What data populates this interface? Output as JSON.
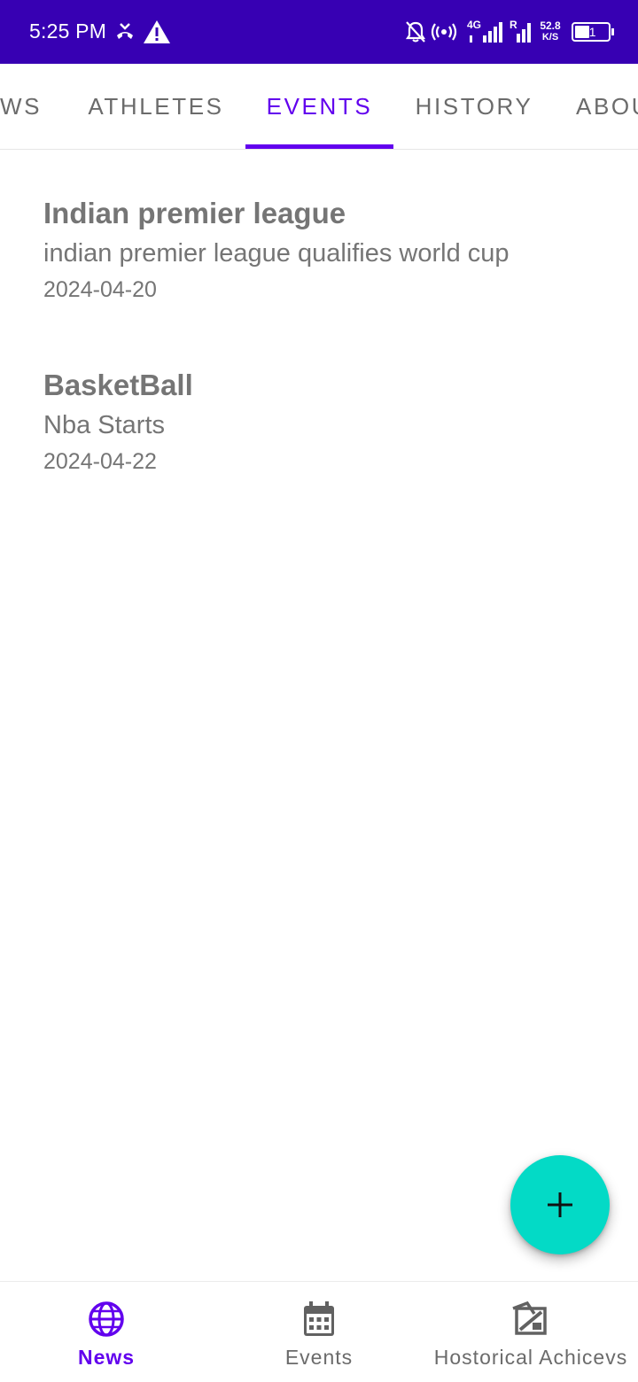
{
  "status_bar": {
    "time": "5:25 PM",
    "network_type": "4G",
    "roaming": "R",
    "speed_value": "52.8",
    "speed_unit": "K/S",
    "battery": "41",
    "icons": [
      "missed-call-icon",
      "warning-icon",
      "bell-off-icon",
      "hotspot-icon",
      "signal-icon",
      "signal-icon",
      "battery-icon"
    ]
  },
  "tabs": [
    {
      "label": "NEWS",
      "visible_text": "WS"
    },
    {
      "label": "ATHLETES"
    },
    {
      "label": "EVENTS",
      "active": true
    },
    {
      "label": "HISTORY"
    },
    {
      "label": "ABOUT",
      "visible_text": "ABOU"
    }
  ],
  "events": [
    {
      "title": "Indian premier league",
      "description": "indian premier league qualifies world cup",
      "date": "2024-04-20"
    },
    {
      "title": "BasketBall",
      "description": "Nba Starts",
      "date": "2024-04-22"
    }
  ],
  "fab": {
    "icon": "plus-icon",
    "color": "#03dac6"
  },
  "bottom_nav": [
    {
      "label": "News",
      "icon": "globe-icon",
      "active": true
    },
    {
      "label": "Events",
      "icon": "calendar-icon"
    },
    {
      "label": "Hostorical Achicevs",
      "icon": "history-icon"
    }
  ],
  "colors": {
    "status_bar": "#3700b3",
    "primary": "#6200ee",
    "accent": "#03dac6",
    "text_secondary": "#757575"
  }
}
